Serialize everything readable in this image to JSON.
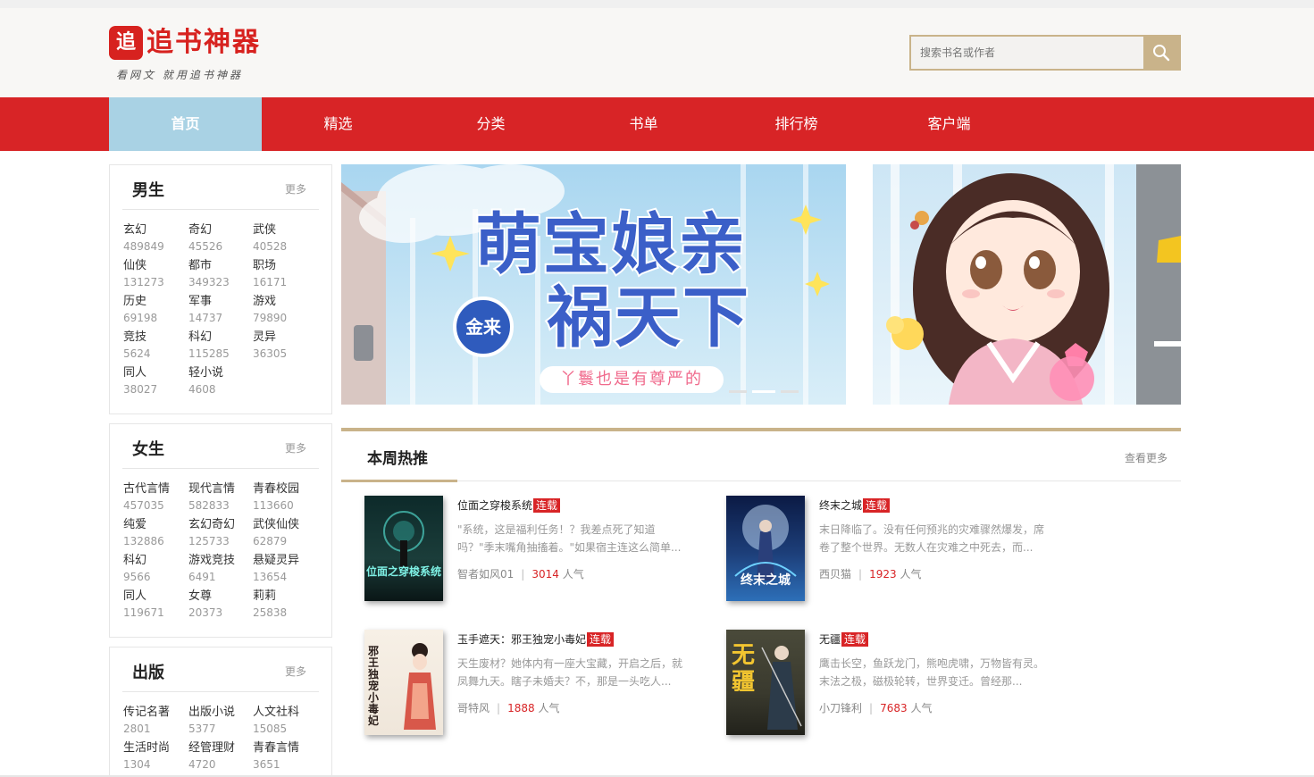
{
  "header": {
    "logo_mark": "追",
    "logo_name": "追书神器",
    "logo_slogan": "看网文 就用追书神器",
    "search_placeholder": "搜索书名或作者"
  },
  "nav": {
    "items": [
      {
        "label": "首页",
        "active": true
      },
      {
        "label": "精选",
        "active": false
      },
      {
        "label": "分类",
        "active": false
      },
      {
        "label": "书单",
        "active": false
      },
      {
        "label": "排行榜",
        "active": false
      },
      {
        "label": "客户端",
        "active": false
      }
    ]
  },
  "panels": [
    {
      "title": "男生",
      "more": "更多",
      "categories": [
        {
          "name": "玄幻",
          "count": "489849"
        },
        {
          "name": "奇幻",
          "count": "45526"
        },
        {
          "name": "武侠",
          "count": "40528"
        },
        {
          "name": "仙侠",
          "count": "131273"
        },
        {
          "name": "都市",
          "count": "349323"
        },
        {
          "name": "职场",
          "count": "16171"
        },
        {
          "name": "历史",
          "count": "69198"
        },
        {
          "name": "军事",
          "count": "14737"
        },
        {
          "name": "游戏",
          "count": "79890"
        },
        {
          "name": "竞技",
          "count": "5624"
        },
        {
          "name": "科幻",
          "count": "115285"
        },
        {
          "name": "灵异",
          "count": "36305"
        },
        {
          "name": "同人",
          "count": "38027"
        },
        {
          "name": "轻小说",
          "count": "4608"
        }
      ]
    },
    {
      "title": "女生",
      "more": "更多",
      "categories": [
        {
          "name": "古代言情",
          "count": "457035"
        },
        {
          "name": "现代言情",
          "count": "582833"
        },
        {
          "name": "青春校园",
          "count": "113660"
        },
        {
          "name": "纯爱",
          "count": "132886"
        },
        {
          "name": "玄幻奇幻",
          "count": "125733"
        },
        {
          "name": "武侠仙侠",
          "count": "62879"
        },
        {
          "name": "科幻",
          "count": "9566"
        },
        {
          "name": "游戏竞技",
          "count": "6491"
        },
        {
          "name": "悬疑灵异",
          "count": "13654"
        },
        {
          "name": "同人",
          "count": "119671"
        },
        {
          "name": "女尊",
          "count": "20373"
        },
        {
          "name": "莉莉",
          "count": "25838"
        }
      ]
    },
    {
      "title": "出版",
      "more": "更多",
      "categories": [
        {
          "name": "传记名著",
          "count": "2801"
        },
        {
          "name": "出版小说",
          "count": "5377"
        },
        {
          "name": "人文社科",
          "count": "15085"
        },
        {
          "name": "生活时尚",
          "count": "1304"
        },
        {
          "name": "经管理财",
          "count": "4720"
        },
        {
          "name": "青春言情",
          "count": "3651"
        }
      ]
    }
  ],
  "banner": {
    "title_line1": "萌宝娘亲",
    "title_line2": "祸天下",
    "subtitle": "丫鬟也是有尊严的",
    "badge": "金来",
    "slides": 3,
    "active_slide": 1
  },
  "hot": {
    "title": "本周热推",
    "more": "查看更多",
    "books": [
      {
        "title": "位面之穿梭系统",
        "status": "连载",
        "desc": "\"系统，这是福利任务！？我差点死了知道吗？\"季末嘴角抽搐着。\"如果宿主连这么简单...",
        "author": "智者如风01",
        "popularity": "3014",
        "pop_unit": "人气",
        "cover_text": "位面之穿梭系统",
        "cover_color": "#1b3d3a"
      },
      {
        "title": "终末之城",
        "status": "连载",
        "desc": "末日降临了。没有任何预兆的灾难骤然爆发，席卷了整个世界。无数人在灾难之中死去，而...",
        "author": "西贝猫",
        "popularity": "1923",
        "pop_unit": "人气",
        "cover_text": "终末之城",
        "cover_color": "#1d3f7a"
      },
      {
        "title": "玉手遮天：邪王独宠小毒妃",
        "status": "连载",
        "desc": "天生废材？她体内有一座大宝藏，开启之后，就凤舞九天。瞎子未婚夫？不，那是一头吃人...",
        "author": "哥特风",
        "popularity": "1888",
        "pop_unit": "人气",
        "cover_text": "邪王独宠小毒妃",
        "cover_color": "#efe6da"
      },
      {
        "title": "无疆",
        "status": "连载",
        "desc": "鹰击长空，鱼跃龙门，熊咆虎啸，万物皆有灵。末法之极，磁极轮转，世界变迁。曾经那...",
        "author": "小刀锋利",
        "popularity": "7683",
        "pop_unit": "人气",
        "cover_text": "无疆",
        "cover_color": "#3a3a2e"
      }
    ]
  }
}
